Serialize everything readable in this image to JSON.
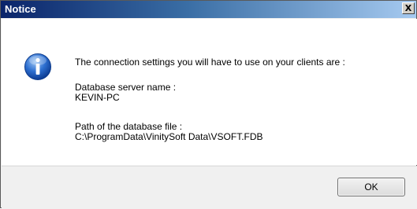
{
  "dialog": {
    "title": "Notice",
    "close_label": "X",
    "icon": "information-icon",
    "message": "The connection settings you will have to use on your clients are :",
    "server_label": "Database server name :",
    "server_value": "KEVIN-PC",
    "path_label": "Path of the database file :",
    "path_value": "C:\\ProgramData\\VinitySoft Data\\VSOFT.FDB",
    "ok_label": "OK"
  }
}
